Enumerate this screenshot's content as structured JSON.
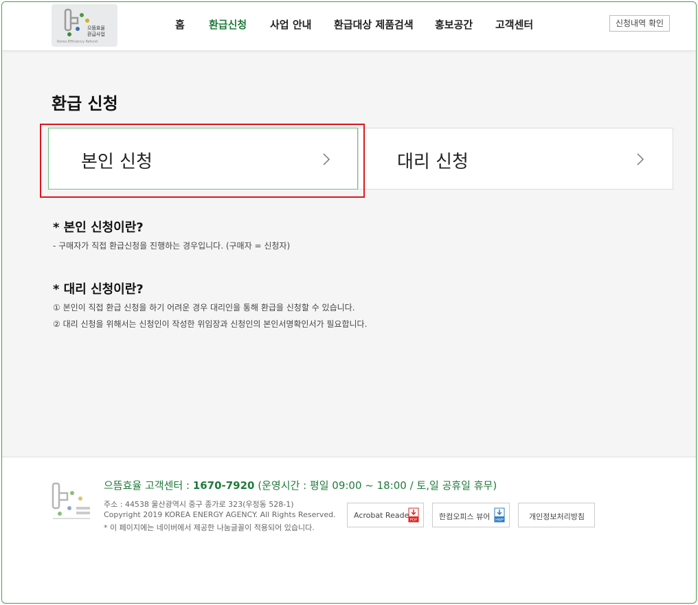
{
  "header": {
    "logo": {
      "line1": "으뜸효율",
      "line2": "환급사업",
      "sub": "Korea Efficiency Refund"
    },
    "nav": [
      {
        "label": "홈"
      },
      {
        "label": "환급신청"
      },
      {
        "label": "사업 안내"
      },
      {
        "label": "환급대상 제품검색"
      },
      {
        "label": "홍보공간"
      },
      {
        "label": "고객센터"
      }
    ],
    "active_index": 1,
    "check_button": "신청내역 확인"
  },
  "main": {
    "title": "환급 신청",
    "options": [
      {
        "label": "본인 신청"
      },
      {
        "label": "대리 신청"
      }
    ],
    "self_section": {
      "title": "* 본인 신청이란?",
      "lines": [
        "- 구매자가 직접 환급신청을 진행하는 경우입니다. (구매자 = 신청자)"
      ]
    },
    "proxy_section": {
      "title": "* 대리 신청이란?",
      "lines": [
        "① 본인이 직접 환급 신청을 하기 어려운 경우 대리인을 통해 환급을 신청할 수 있습니다.",
        "② 대리 신청을 위해서는 신청인이 작성한 위임장과 신청인의 본인서명확인서가 필요합니다."
      ]
    }
  },
  "footer": {
    "center_prefix": "으뜸효율 고객센터 : ",
    "center_phone": "1670-7920",
    "center_hours": "(운영시간 : 평일 09:00 ~ 18:00 / 토,일 공휴일 휴무)",
    "address": "주소 : 44538 울산광역시 중구 종가로 323(우정동 528-1)",
    "copyright": "Copyright 2019 KOREA ENERGY AGENCY. All Rights Reserved.",
    "note": "* 이 페이지에는 네이버에서 제공한 나눔글꼴이 적용되어 있습니다.",
    "buttons": [
      {
        "label": "Acrobat Reader",
        "icon": "pdf-download-icon",
        "icon_text": "PDF"
      },
      {
        "label": "한컴오피스 뷰어",
        "icon": "hwp-download-icon",
        "icon_text": "HWP"
      },
      {
        "label": "개인정보처리방침"
      }
    ]
  },
  "colors": {
    "accent_green": "#1f7a3a",
    "highlight_red": "#e0141a",
    "frame_green": "#3aa047"
  }
}
